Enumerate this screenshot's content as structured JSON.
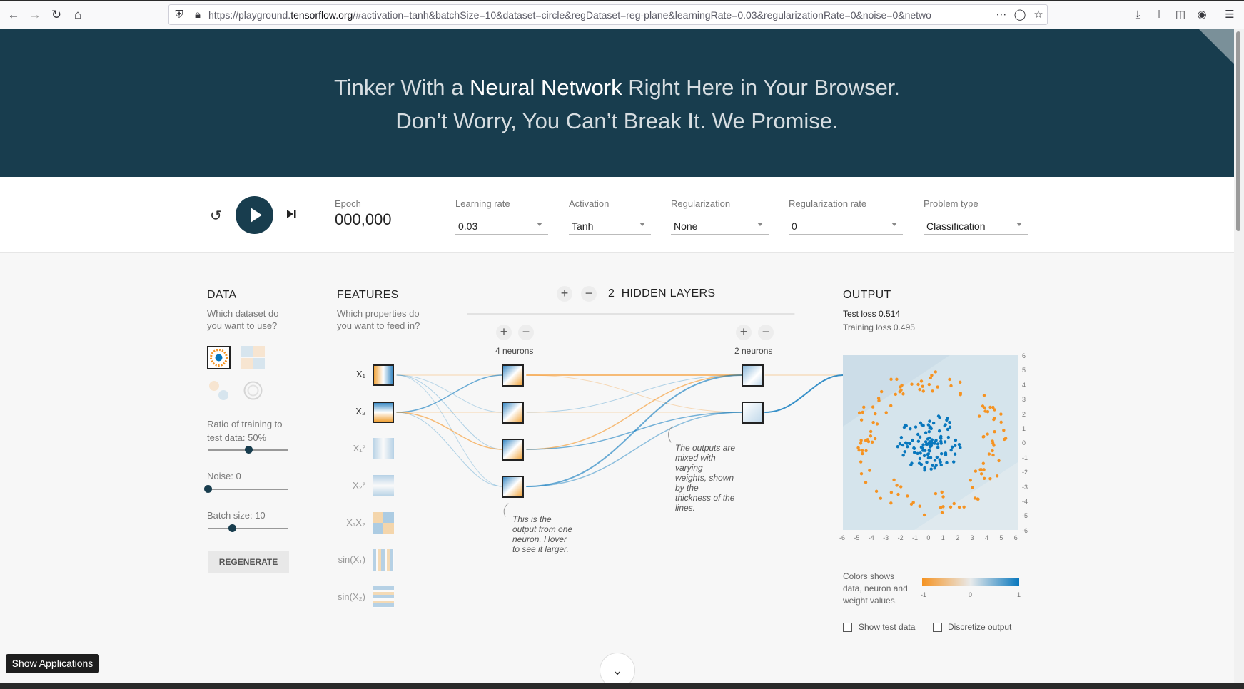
{
  "browser": {
    "url_prefix": "https://playground.",
    "url_domain": "tensorflow.org",
    "url_rest": "/#activation=tanh&batchSize=10&dataset=circle&regDataset=reg-plane&learningRate=0.03&regularizationRate=0&noise=0&netwo",
    "icons": [
      "back-icon",
      "forward-icon",
      "reload-icon",
      "home-icon",
      "shield-icon",
      "lock-icon",
      "more-icon",
      "pocket-icon",
      "star-icon",
      "download-icon",
      "library-icon",
      "sidebar-icon",
      "account-icon",
      "menu-icon"
    ]
  },
  "header": {
    "line1_pre": "Tinker With a ",
    "line1_strong": "Neural Network",
    "line1_post": " Right Here in Your Browser.",
    "line2": "Don’t Worry, You Can’t Break It. We Promise."
  },
  "controls": {
    "epoch_label": "Epoch",
    "epoch_value": "000,000",
    "learning_rate": {
      "label": "Learning rate",
      "value": "0.03"
    },
    "activation": {
      "label": "Activation",
      "value": "Tanh"
    },
    "regularization": {
      "label": "Regularization",
      "value": "None"
    },
    "regularization_rate": {
      "label": "Regularization rate",
      "value": "0"
    },
    "problem_type": {
      "label": "Problem type",
      "value": "Classification"
    }
  },
  "data_panel": {
    "title": "DATA",
    "subtitle_1": "Which dataset do",
    "subtitle_2": "you want to use?",
    "ratio_label": "Ratio of training to",
    "ratio_label_2": "test data:  50%",
    "ratio_value": 0.5,
    "noise_label": "Noise:  0",
    "noise_value": 0,
    "batch_label": "Batch size:  10",
    "batch_value": 0.3,
    "regenerate": "REGENERATE"
  },
  "features_panel": {
    "title": "FEATURES",
    "subtitle_1": "Which properties do",
    "subtitle_2": "you want to feed in?",
    "features": [
      {
        "label": "X₁",
        "active": true
      },
      {
        "label": "X₂",
        "active": true
      },
      {
        "label": "X₁²",
        "active": false
      },
      {
        "label": "X₂²",
        "active": false
      },
      {
        "label": "X₁X₂",
        "active": false
      },
      {
        "label": "sin(X₁)",
        "active": false
      },
      {
        "label": "sin(X₂)",
        "active": false
      }
    ]
  },
  "network": {
    "layers_count": "2",
    "layers_label": "HIDDEN LAYERS",
    "layer1_label": "4 neurons",
    "layer2_label": "2 neurons",
    "note_left": [
      "This is the",
      "output from one",
      "neuron. Hover",
      "to see it larger."
    ],
    "note_right": [
      "The outputs are",
      "mixed with",
      "varying",
      "weights, shown",
      "by the",
      "thickness of the",
      "lines."
    ]
  },
  "output_panel": {
    "title": "OUTPUT",
    "test_loss": "Test loss 0.514",
    "training_loss": "Training loss 0.495",
    "y_ticks": [
      "6",
      "5",
      "4",
      "3",
      "2",
      "1",
      "0",
      "-1",
      "-2",
      "-3",
      "-4",
      "-5",
      "-6"
    ],
    "x_ticks": [
      "-6",
      "-5",
      "-4",
      "-3",
      "-2",
      "-1",
      "0",
      "1",
      "2",
      "3",
      "4",
      "5",
      "6"
    ],
    "legend_text": [
      "Colors shows",
      "data, neuron and",
      "weight values."
    ],
    "legend_ticks": [
      "-1",
      "0",
      "1"
    ],
    "show_test_data": "Show test data",
    "discretize_output": "Discretize output"
  },
  "colors": {
    "header_bg": "#183d4e",
    "orange": "#f59322",
    "blue": "#0877bd"
  },
  "taskbar": {
    "show_applications": "Show Applications"
  }
}
